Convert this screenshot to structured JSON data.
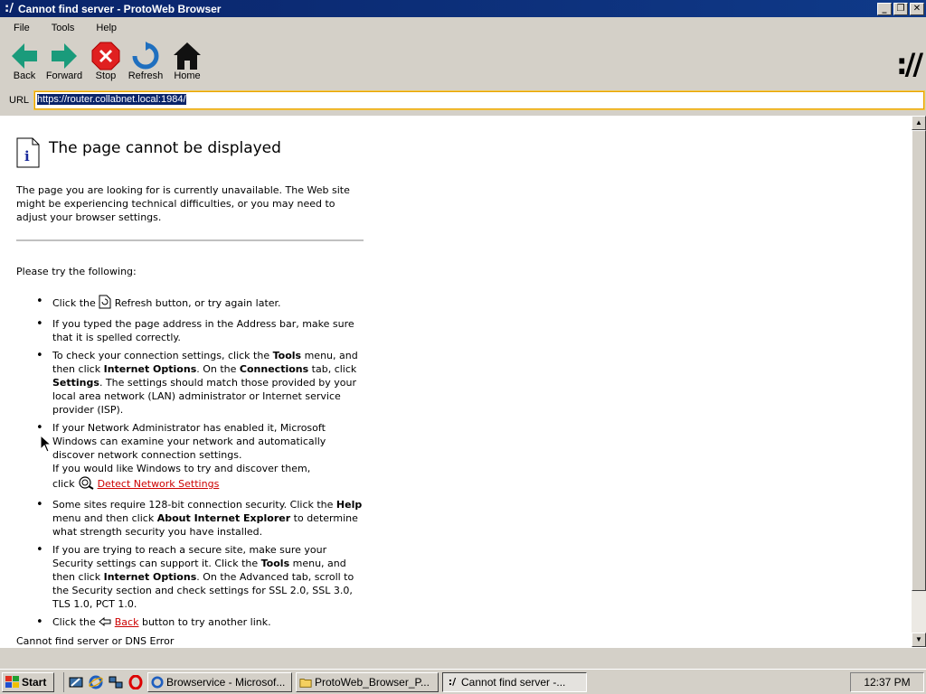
{
  "window": {
    "title": "Cannot find server - ProtoWeb Browser",
    "app_icon": "protoweb-logo-icon"
  },
  "menu": [
    "File",
    "Tools",
    "Help"
  ],
  "toolbar": {
    "back": "Back",
    "forward": "Forward",
    "stop": "Stop",
    "refresh": "Refresh",
    "home": "Home",
    "logo_text": "://"
  },
  "urlbar": {
    "label": "URL",
    "value": "https://router.collabnet.local:1984/"
  },
  "page": {
    "title": "The page cannot be displayed",
    "intro": "The page you are looking for is currently unavailable. The Web site might be experiencing technical difficulties, or you may need to adjust your browser settings.",
    "try_heading": "Please try the following:",
    "tip1_pre": "Click the ",
    "tip1_post": " Refresh button, or try again later.",
    "tip2": "If you typed the page address in the Address bar, make sure that it is spelled correctly.",
    "tip3_a": "To check your connection settings, click the ",
    "tip3_b": "Tools",
    "tip3_c": " menu, and then click ",
    "tip3_d": "Internet Options",
    "tip3_e": ". On the ",
    "tip3_f": "Connections",
    "tip3_g": " tab, click ",
    "tip3_h": "Settings",
    "tip3_i": ". The settings should match those provided by your local area network (LAN) administrator or Internet service provider (ISP).",
    "tip4_a": "If your Network Administrator has enabled it, Microsoft Windows can examine your network and automatically discover network connection settings.",
    "tip4_b": "If you would like Windows to try and discover them,",
    "tip4_c": "click ",
    "tip4_link": "Detect Network Settings",
    "tip5_a": "Some sites require 128-bit connection security. Click the ",
    "tip5_b": "Help",
    "tip5_c": " menu and then click ",
    "tip5_d": "About Internet Explorer",
    "tip5_e": " to determine what strength security you have installed.",
    "tip6_a": "If you are trying to reach a secure site, make sure your Security settings can support it. Click the ",
    "tip6_b": "Tools",
    "tip6_c": " menu, and then click ",
    "tip6_d": "Internet Options",
    "tip6_e": ". On the Advanced tab, scroll to the Security section and check settings for SSL 2.0, SSL 3.0, TLS 1.0, PCT 1.0.",
    "tip7_pre": "Click the ",
    "tip7_link": "Back",
    "tip7_post": " button to try another link.",
    "footer": "Cannot find server or DNS Error"
  },
  "taskbar": {
    "start": "Start",
    "tasks": [
      {
        "label": "Browservice - Microsof...",
        "icon": "ie-icon"
      },
      {
        "label": "ProtoWeb_Browser_P...",
        "icon": "folder-icon"
      },
      {
        "label": "Cannot find server -...",
        "icon": "protoweb-icon"
      }
    ],
    "clock": "12:37 PM"
  },
  "colors": {
    "titlebar": "#0a246a",
    "link": "#cc0000",
    "url_focus": "#e8a200",
    "arrow_green": "#1a9b7b",
    "stop_red": "#e02020",
    "refresh_blue": "#1f6fbf"
  }
}
